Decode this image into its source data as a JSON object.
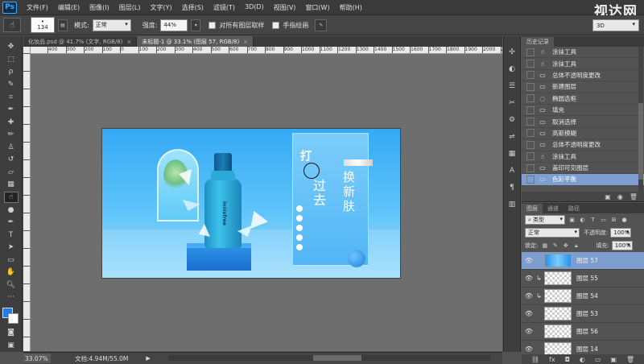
{
  "menu": {
    "logo": "Ps",
    "items": [
      "文件(F)",
      "编辑(E)",
      "图像(I)",
      "图层(L)",
      "文字(Y)",
      "选择(S)",
      "滤镜(T)",
      "3D(D)",
      "视图(V)",
      "窗口(W)",
      "帮助(H)"
    ],
    "watermark": "视达网"
  },
  "options": {
    "brush_size": "134",
    "mode_label": "模式:",
    "mode_value": "正常",
    "strength_label": "强度:",
    "strength_value": "44%",
    "sample_all_label": "对所有图层取样",
    "finger_label": "手指绘画",
    "workspace": "3D"
  },
  "tabs": [
    {
      "label": "化妆品.psd @ 41.7% (文字, RGB/8)",
      "close": "×"
    },
    {
      "label": "未标题-1 @ 33.1% (图层 57, RGB/8)",
      "close": "×"
    }
  ],
  "ruler": {
    "h_ticks": [
      "400",
      "300",
      "200",
      "100",
      "0",
      "100",
      "200",
      "300",
      "400",
      "500",
      "600",
      "700",
      "800",
      "900",
      "1000",
      "1100",
      "1200",
      "1300",
      "1400",
      "1500",
      "1600",
      "1700",
      "1800",
      "1900",
      "2000",
      "2100"
    ]
  },
  "design": {
    "vertical_text_1": "打",
    "vertical_text_2": "过去",
    "vertical_text_3": "换新肤",
    "bottle_label": "innisfree"
  },
  "history": {
    "tabs": [
      "历史记录"
    ],
    "items": [
      {
        "label": "涂抹工具",
        "icon": "☝"
      },
      {
        "label": "涂抹工具",
        "icon": "☝"
      },
      {
        "label": "总体不透明度更改",
        "icon": "▭"
      },
      {
        "label": "新建图层",
        "icon": "▭"
      },
      {
        "label": "椭圆选框",
        "icon": "◌"
      },
      {
        "label": "填充",
        "icon": "▭"
      },
      {
        "label": "取消选择",
        "icon": "▭"
      },
      {
        "label": "高斯模糊",
        "icon": "▭"
      },
      {
        "label": "总体不透明度更改",
        "icon": "▭"
      },
      {
        "label": "涂抹工具",
        "icon": "☝"
      },
      {
        "label": "盖印可见图层",
        "icon": "▭"
      },
      {
        "label": "色彩平衡",
        "icon": "▭"
      }
    ],
    "selected_index": 11
  },
  "layers": {
    "tabs": [
      "图层",
      "通道",
      "路径"
    ],
    "filter_label": "类型",
    "blend_mode": "正常",
    "opacity_label": "不透明度:",
    "opacity_value": "100%",
    "lock_label": "锁定:",
    "fill_label": "填充:",
    "fill_value": "100%",
    "items": [
      {
        "name": "图层 57",
        "clipped": false
      },
      {
        "name": "图层 55",
        "clipped": true
      },
      {
        "name": "图层 54",
        "clipped": true
      },
      {
        "name": "图层 53",
        "clipped": false
      },
      {
        "name": "图层 56",
        "clipped": false
      },
      {
        "name": "图层 14",
        "clipped": false
      }
    ],
    "selected_index": 0
  },
  "status": {
    "zoom": "33.07%",
    "doc": "文档:4.94M/55.0M",
    "arrow": "▶"
  },
  "colors": {
    "foreground": "#1e7be8",
    "background": "#ffffff",
    "selection": "#7e9ed0"
  }
}
